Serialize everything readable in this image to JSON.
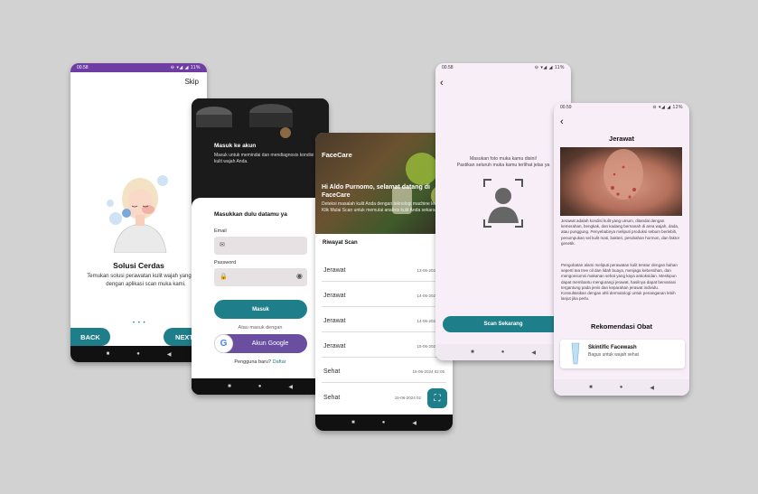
{
  "colors": {
    "teal": "#1e7f8a",
    "purple": "#6f3ca3",
    "google_button": "#6a4fa0"
  },
  "onboarding": {
    "status_time": "00.58",
    "status_icons": "⊖ ▾◢ ◢ 11%",
    "skip": "Skip",
    "title": "Solusi Cerdas",
    "description": "Temukan solusi perawatan kulit wajah yang tepat dengan aplikasi scan muka kami.",
    "back": "BACK",
    "next": "NEXT"
  },
  "login": {
    "hero_title": "Masuk ke akun",
    "hero_desc": "Masuk untuk memindai dan mendiagnosis kondisi kulit wajah Anda.",
    "card_title": "Masukkan dulu datamu ya",
    "email_label": "Email",
    "password_label": "Password",
    "submit": "Masuk",
    "or_text": "Atau masuk dengan",
    "google": "Akun Google",
    "register_prompt": "Pengguna baru?",
    "register_link": "Daftar"
  },
  "home": {
    "brand": "FaceCare",
    "greeting": "Hi Aldo Purnomo, selamat datang di FaceCare",
    "greeting_desc": "Deteksi masalah kulit Anda dengan teknologi machine learning. Klik Mulai Scan untuk memulai analisis kulit Anda sekarang juga!",
    "history_title": "Riwayat Scan",
    "history": [
      {
        "name": "Jerawat",
        "date": "13-06-2024 23:"
      },
      {
        "name": "Jerawat",
        "date": "14-06-2024 22:"
      },
      {
        "name": "Jerawat",
        "date": "14-06-2024 22:"
      },
      {
        "name": "Jerawat",
        "date": "15-06-2024 00:"
      },
      {
        "name": "Sehat",
        "date": "15-06-2024 02:05"
      },
      {
        "name": "Sehat",
        "date": "15-06-2024 02"
      }
    ]
  },
  "scan": {
    "status_time": "00.58",
    "status_icons": "⊖ ▾◢ ◢ 11%",
    "instructions": "Masukan foto muka kamu disini!\nPastikan seluruh muka kamu terlihat jelas ya",
    "scan_button": "Scan Sekarang"
  },
  "result": {
    "status_time": "00.59",
    "status_icons": "⊖ ▾◢ ◢ 12%",
    "title": "Jerawat",
    "paragraph1": "Jerawat adalah kondisi kulit yang umum, ditandai dengan kemerahan, bengkak, dan kadang bernanah di area wajah, dada, atau punggung. Penyebabnya meliputi produksi sebum berlebih, penumpukan sel kulit mati, bakteri, perubahan hormon, dan faktor genetik.",
    "paragraph2": "Pengobatan alami meliputi perawatan kulit teratur dengan bahan seperti tea tree oil dan lidah buaya, menjaga kebersihan, dan mengonsumsi makanan sehat yang kaya antioksidan. Meskipun dapat membantu mengurangi jerawat, hasilnya dapat bervariasi tergantung pada jenis dan keparahan jerawat individu. Konsultasikan dengan ahli dermatologi untuk penanganan lebih lanjut jika perlu.",
    "recommendation_title": "Rekomendasi Obat",
    "product_name": "Skintific Facewash",
    "product_desc": "Bagus untuk wajah sehat"
  },
  "nav": {
    "square": "■",
    "circle": "●",
    "back": "◀"
  }
}
